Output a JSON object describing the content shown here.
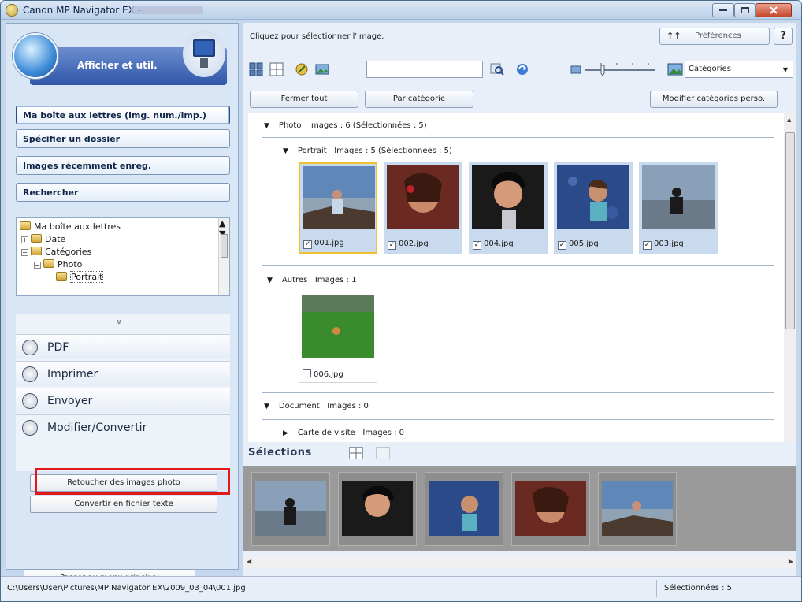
{
  "window": {
    "title": "Canon MP Navigator EX -"
  },
  "colors": {
    "highlight_frame": "#e0181c",
    "selection_tray": "#9a9a9a",
    "accent_blue": "#2f56a8"
  },
  "left_panel": {
    "mode_label": "Afficher et util.",
    "nav": [
      "Ma boîte aux lettres (img. num./imp.)",
      "Spécifier un dossier",
      "Images récemment enreg.",
      "Rechercher"
    ],
    "tree": [
      {
        "label": "Ma boîte aux lettres",
        "expander": ""
      },
      {
        "label": "Date",
        "expander": "+"
      },
      {
        "label": "Catégories",
        "expander": "−"
      },
      {
        "label": "Photo",
        "expander": "−"
      },
      {
        "label": "Portrait",
        "expander": ""
      }
    ],
    "collapse_glyph": "»",
    "functions": [
      {
        "label": "PDF",
        "icon": "pdf-icon"
      },
      {
        "label": "Imprimer",
        "icon": "printer-icon"
      },
      {
        "label": "Envoyer",
        "icon": "envelope-icon"
      },
      {
        "label": "Modifier/Convertir",
        "icon": "pencil-icon"
      }
    ],
    "sub_buttons": [
      "Retoucher des images photo",
      "Convertir en fichier texte"
    ],
    "main_menu_button": "Passer au menu principal"
  },
  "right_panel": {
    "hint": "Cliquez pour sélectionner l'image.",
    "preferences_label": "Préférences",
    "preferences_glyph": "↑↑",
    "help_label": "?",
    "search_value": "",
    "category_select": "Catégories",
    "buttons": {
      "close_all": "Fermer tout",
      "by_category": "Par catégorie",
      "edit_categories": "Modifier catégories perso."
    },
    "groups": {
      "photo": {
        "name": "Photo",
        "info": "Images : 6   (Sélectionnées : 5)"
      },
      "portrait": {
        "name": "Portrait",
        "info": "Images : 5   (Sélectionnées : 5)"
      },
      "others": {
        "name": "Autres",
        "info": "Images : 1"
      },
      "document": {
        "name": "Document",
        "info": "Images : 0"
      },
      "card": {
        "name": "Carte de visite",
        "info": "Images : 0"
      }
    },
    "portrait_images": [
      {
        "file": "001.jpg",
        "checked": "✓"
      },
      {
        "file": "002.jpg",
        "checked": "✓"
      },
      {
        "file": "004.jpg",
        "checked": "✓"
      },
      {
        "file": "005.jpg",
        "checked": "✓"
      },
      {
        "file": "003.jpg",
        "checked": "✓"
      }
    ],
    "other_images": [
      {
        "file": "006.jpg",
        "checked": ""
      }
    ],
    "selections_title": "Sélections"
  },
  "status": {
    "path": "C:\\Users\\User\\Pictures\\MP Navigator EX\\2009_03_04\\001.jpg",
    "selected": "Sélectionnées : 5"
  }
}
